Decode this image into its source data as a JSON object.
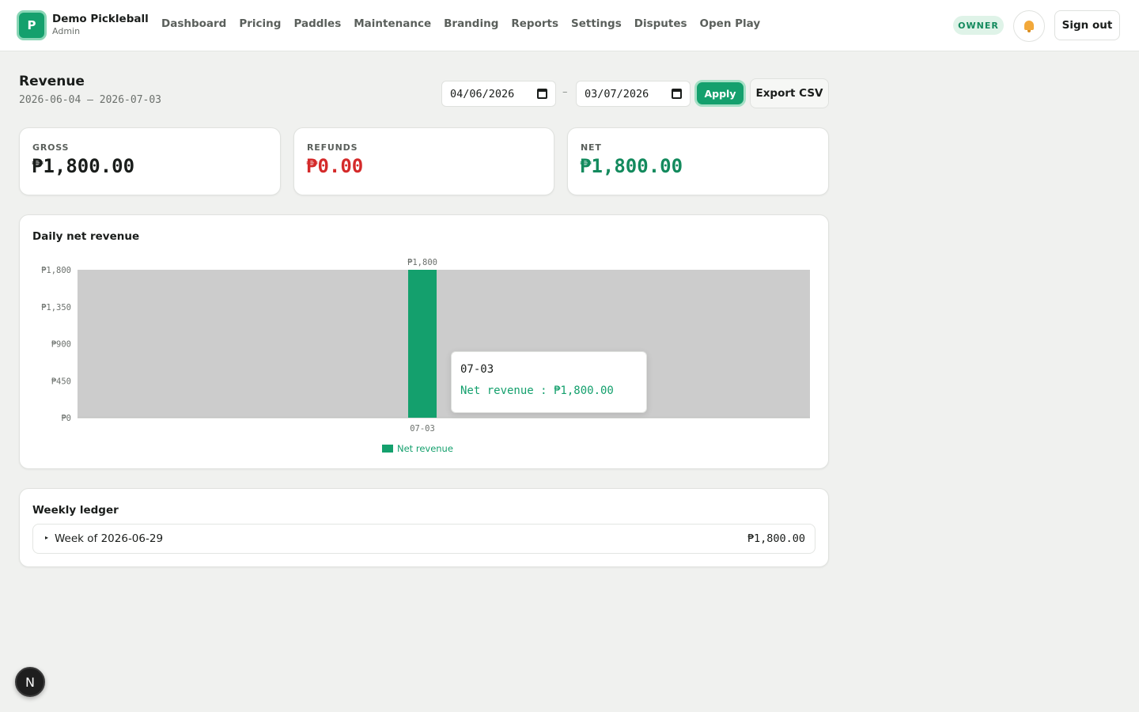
{
  "header": {
    "logo_letter": "P",
    "brand_name": "Demo Pickleball",
    "brand_role": "Admin",
    "nav": [
      "Dashboard",
      "Pricing",
      "Paddles",
      "Maintenance",
      "Branding",
      "Reports",
      "Settings",
      "Disputes",
      "Open Play"
    ],
    "owner_badge": "OWNER",
    "bell_icon": "bell-icon",
    "signout_label": "Sign out"
  },
  "page": {
    "title": "Revenue",
    "range": "2026-06-04 – 2026-07-03",
    "date_from": "04/06/2026",
    "date_sep": "–",
    "date_to": "03/07/2026",
    "apply_label": "Apply",
    "export_label": "Export CSV"
  },
  "kpis": [
    {
      "label": "GROSS",
      "value": "₱1,800.00",
      "color": "#1a1d1b"
    },
    {
      "label": "REFUNDS",
      "value": "₱0.00",
      "color": "#d42a2a"
    },
    {
      "label": "NET",
      "value": "₱1,800.00",
      "color": "#138a5d"
    }
  ],
  "chart_title": "Daily net revenue",
  "chart_data": {
    "type": "bar",
    "categories": [
      "07-03"
    ],
    "series": [
      {
        "name": "Net revenue",
        "values": [
          1800
        ]
      }
    ],
    "y_ticks": [
      "₱0",
      "₱450",
      "₱900",
      "₱1,350",
      "₱1,800"
    ],
    "y_tick_values": [
      0,
      450,
      900,
      1350,
      1800
    ],
    "data_labels": [
      "₱1,800"
    ],
    "ylim": [
      0,
      1800
    ],
    "bar_color": "#14a06d",
    "legend": "bottom-center"
  },
  "tooltip": {
    "label": "07-03",
    "value": "Net revenue : ₱1,800.00"
  },
  "ledger": {
    "title": "Weekly ledger",
    "rows": [
      {
        "label": "Week of 2026-06-29",
        "amount": "₱1,800.00"
      }
    ]
  },
  "fab_letter": "N"
}
